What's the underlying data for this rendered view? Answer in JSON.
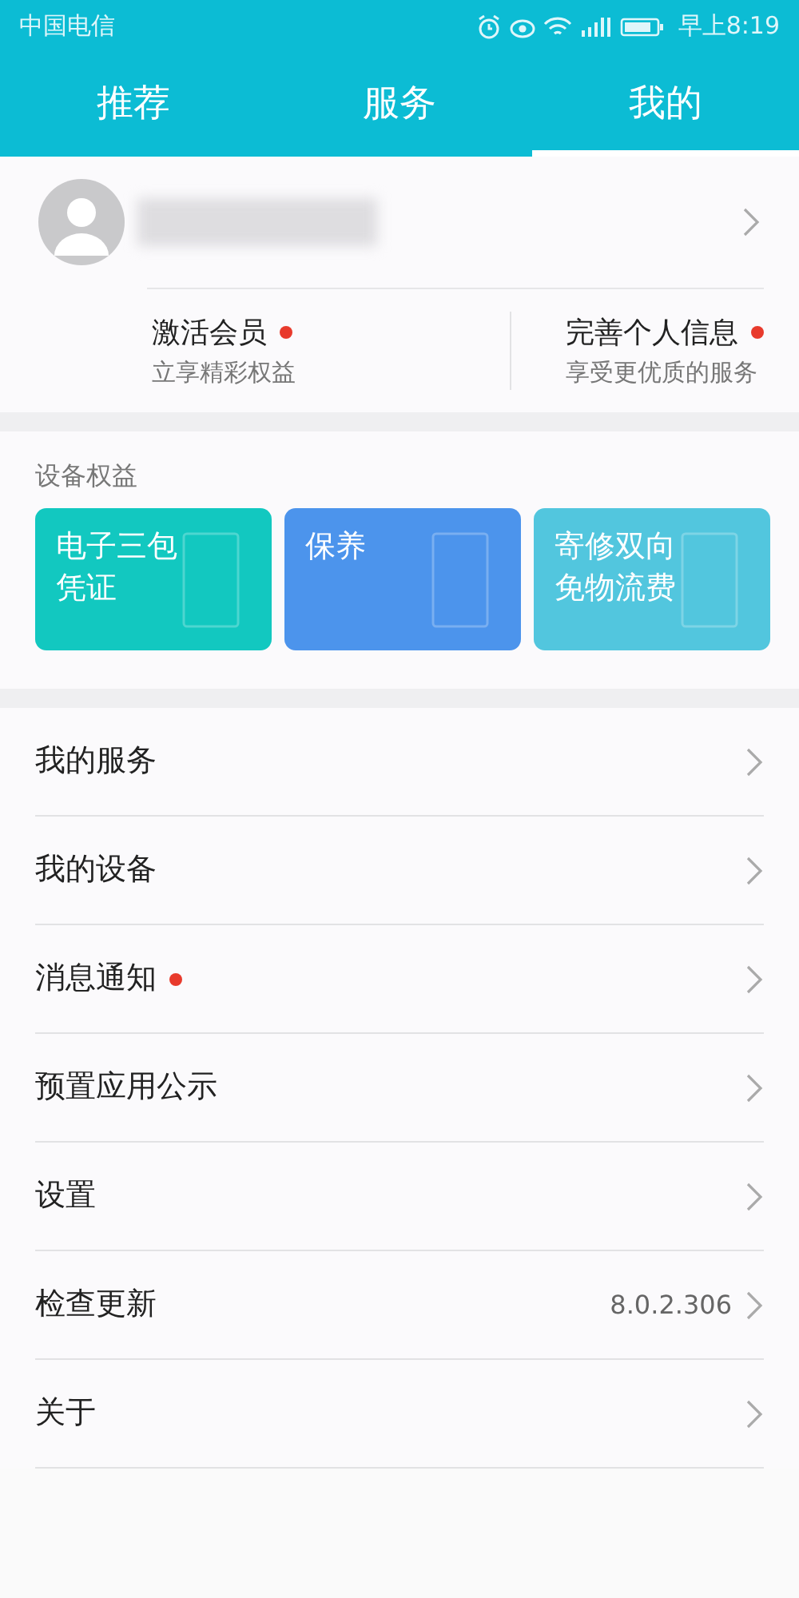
{
  "status_bar": {
    "carrier": "中国电信",
    "time": "早上8:19"
  },
  "tabs": [
    {
      "label": "推荐",
      "selected": false
    },
    {
      "label": "服务",
      "selected": false
    },
    {
      "label": "我的",
      "selected": true
    }
  ],
  "profile": {
    "actions": [
      {
        "title": "激活会员",
        "subtitle": "立享精彩权益",
        "has_dot": true
      },
      {
        "title": "完善个人信息",
        "subtitle": "享受更优质的服务",
        "has_dot": true
      }
    ]
  },
  "benefits": {
    "heading": "设备权益",
    "cards": [
      {
        "title": "电子三包凭证",
        "color": "#12c8c0"
      },
      {
        "title": "保养",
        "color": "#4c94ec"
      },
      {
        "title": "寄修双向免物流费",
        "color": "#52c6de"
      }
    ]
  },
  "menu": [
    {
      "label": "我的服务",
      "has_dot": false
    },
    {
      "label": "我的设备",
      "has_dot": false
    },
    {
      "label": "消息通知",
      "has_dot": true
    },
    {
      "label": "预置应用公示",
      "has_dot": false
    },
    {
      "label": "设置",
      "has_dot": false
    },
    {
      "label": "检查更新",
      "has_dot": false,
      "value": "8.0.2.306"
    },
    {
      "label": "关于",
      "has_dot": false
    }
  ]
}
